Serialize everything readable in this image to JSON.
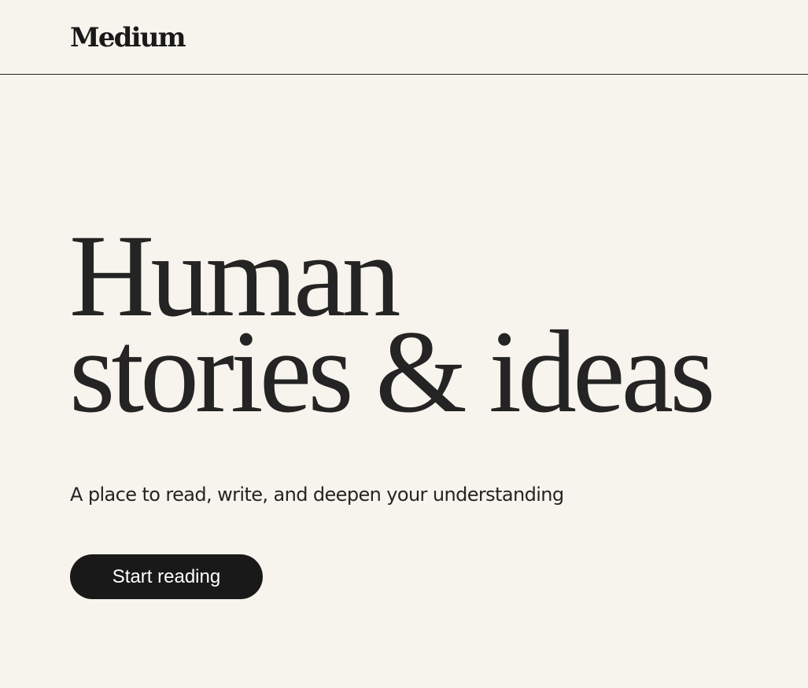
{
  "header": {
    "logo_text": "Medium"
  },
  "hero": {
    "title_line1": "Human",
    "title_line2": "stories & ideas",
    "subtitle": "A place to read, write, and deepen your understanding",
    "cta_label": "Start reading"
  },
  "colors": {
    "background": "#f7f4ed",
    "text": "#242424",
    "button_bg": "#191919",
    "button_text": "#ffffff"
  }
}
